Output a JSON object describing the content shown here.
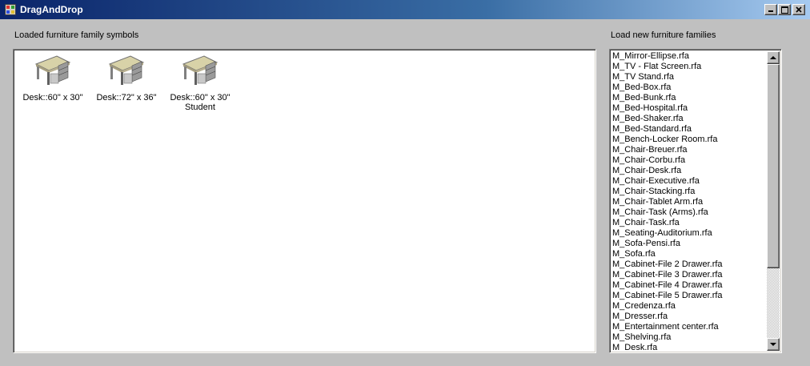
{
  "window": {
    "title": "DragAndDrop",
    "title_bar_color": "#0a246a",
    "controls": [
      "minimize-icon",
      "maximize-icon",
      "close-icon"
    ]
  },
  "loaded_panel": {
    "label": "Loaded furniture family symbols",
    "symbols": [
      {
        "label": "Desk::60\" x 30\"",
        "icon": "desk-icon"
      },
      {
        "label": "Desk::72\" x 36\"",
        "icon": "desk-icon"
      },
      {
        "label": "Desk::60\" x 30\" Student",
        "icon": "desk-icon"
      }
    ]
  },
  "families_panel": {
    "label": "Load new furniture families",
    "files": [
      "M_Mirror-Ellipse.rfa",
      "M_TV - Flat Screen.rfa",
      "M_TV Stand.rfa",
      "M_Bed-Box.rfa",
      "M_Bed-Bunk.rfa",
      "M_Bed-Hospital.rfa",
      "M_Bed-Shaker.rfa",
      "M_Bed-Standard.rfa",
      "M_Bench-Locker Room.rfa",
      "M_Chair-Breuer.rfa",
      "M_Chair-Corbu.rfa",
      "M_Chair-Desk.rfa",
      "M_Chair-Executive.rfa",
      "M_Chair-Stacking.rfa",
      "M_Chair-Tablet Arm.rfa",
      "M_Chair-Task (Arms).rfa",
      "M_Chair-Task.rfa",
      "M_Seating-Auditorium.rfa",
      "M_Sofa-Pensi.rfa",
      "M_Sofa.rfa",
      "M_Cabinet-File 2 Drawer.rfa",
      "M_Cabinet-File 3 Drawer.rfa",
      "M_Cabinet-File 4 Drawer.rfa",
      "M_Cabinet-File 5 Drawer.rfa",
      "M_Credenza.rfa",
      "M_Dresser.rfa",
      "M_Entertainment center.rfa",
      "M_Shelving.rfa",
      "M_Desk.rfa"
    ]
  }
}
